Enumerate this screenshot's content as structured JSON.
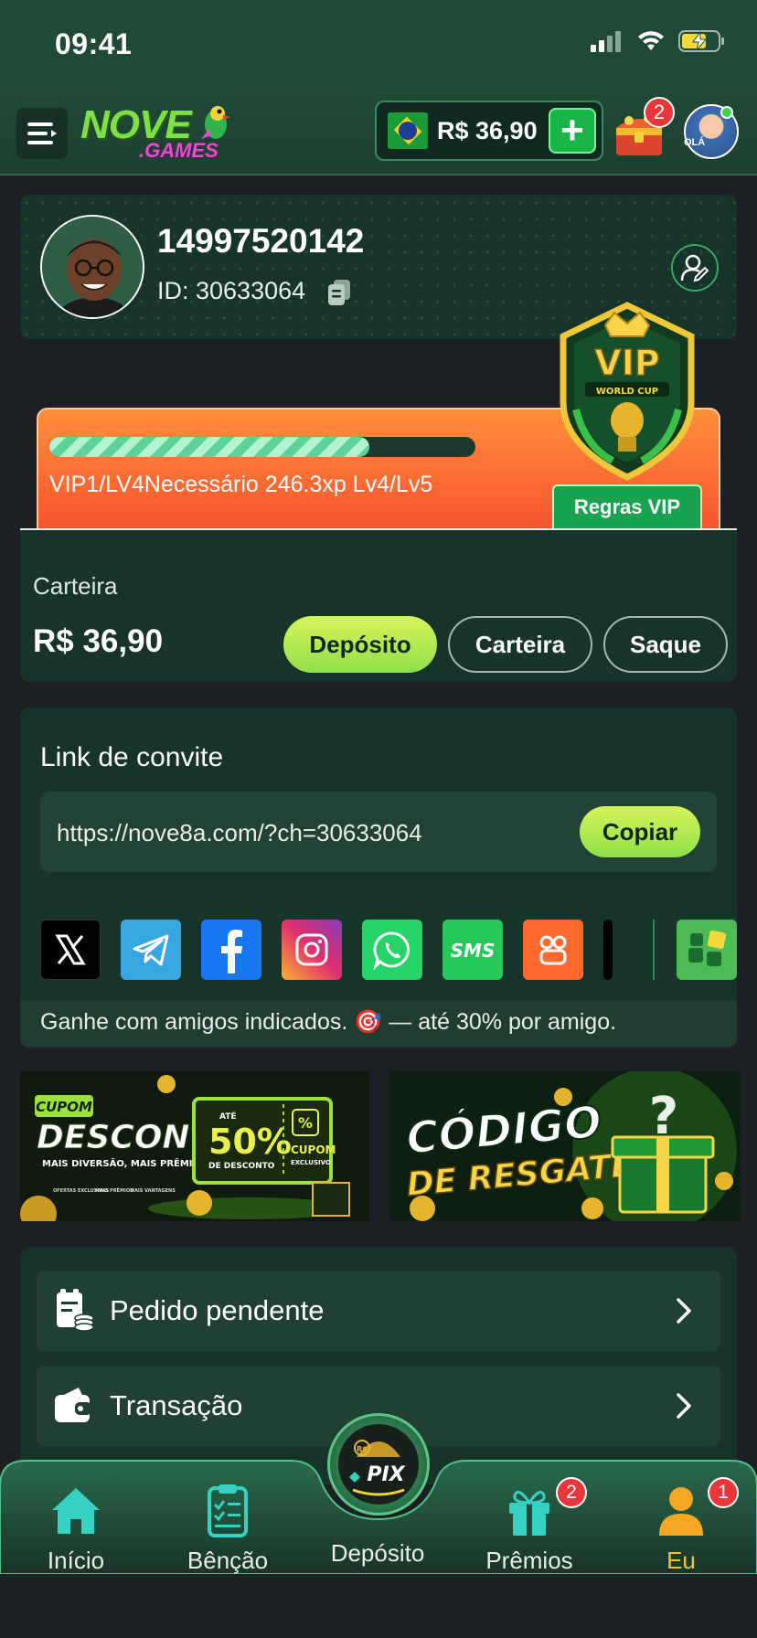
{
  "status_bar": {
    "time": "09:41"
  },
  "header": {
    "logo_main": "NOVE",
    "logo_sub": ".GAMES",
    "balance": "R$ 36,90",
    "add_symbol": "+",
    "gift_badge": "2",
    "avatar_label": "OLÁ"
  },
  "profile": {
    "phone": "14997520142",
    "id_text": "ID: 30633064"
  },
  "vip": {
    "progress_text": "VIP1/LV4Necessário 246.3xp Lv4/Lv5",
    "progress_fraction": 0.75,
    "rules_label": "Regras VIP",
    "badge_title": "VIP",
    "badge_sub": "WORLD CUP"
  },
  "wallet": {
    "label": "Carteira",
    "amount": "R$ 36,90",
    "deposit_label": "Depósito",
    "wallet_label": "Carteira",
    "withdraw_label": "Saque"
  },
  "invite": {
    "title": "Link de convite",
    "url": "https://nove8a.com/?ch=30633064",
    "copy_label": "Copiar",
    "share": [
      {
        "name": "x-icon",
        "glyph": "𝕏",
        "color": "#000000"
      },
      {
        "name": "telegram-icon",
        "glyph": "➤",
        "color": "#38a6e0"
      },
      {
        "name": "facebook-icon",
        "glyph": "f",
        "color": "#1877f2"
      },
      {
        "name": "instagram-icon",
        "glyph": "◎",
        "color": "#e1306c"
      },
      {
        "name": "whatsapp-icon",
        "glyph": "✆",
        "color": "#25d366"
      },
      {
        "name": "sms-icon",
        "glyph": "SMS",
        "color": "#25c95a"
      },
      {
        "name": "kwai-icon",
        "glyph": "✿",
        "color": "#ff6a2c"
      }
    ],
    "footer_text": "Ganhe com amigos indicados. 🎯 — até 30% por amigo."
  },
  "banners": {
    "left": {
      "tag": "CUPOM",
      "title": "DESCONTO",
      "sub": "MAIS DIVERSÃO, MAIS PRÊMIOS!",
      "percent": "50%",
      "percent_prefix": "ATÉ",
      "percent_sub": "DE DESCONTO",
      "coupon_title": "CUPOM",
      "coupon_sub": "EXCLUSIVO",
      "coupon_symbol": "%",
      "feature_1": "OFERTAS EXCLUSIVAS",
      "feature_2": "MAIS PRÊMIOS",
      "feature_3": "MAIS VANTAGENS"
    },
    "right": {
      "line1": "CÓDIGO",
      "line2": "DE RESGATE",
      "symbol": "?"
    }
  },
  "menu": [
    {
      "label": "Pedido pendente"
    },
    {
      "label": "Transação"
    }
  ],
  "bottom_nav": {
    "items": [
      {
        "label": "Início"
      },
      {
        "label": "Bênção"
      },
      {
        "label": "Depósito"
      },
      {
        "label": "Prêmios",
        "badge": "2"
      },
      {
        "label": "Eu",
        "badge": "1"
      }
    ],
    "pix_label": "PIX",
    "pix_currency": "R$"
  },
  "colors": {
    "accent_green": "#8fe04a",
    "active_tab": "#f5c42c",
    "badge_red": "#e8363a",
    "card_bg": "#17342a"
  }
}
